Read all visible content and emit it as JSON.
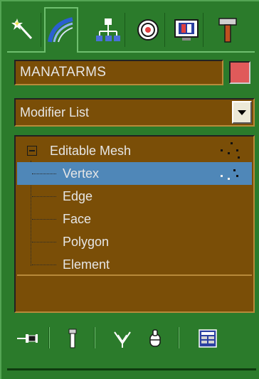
{
  "command_panel": {
    "tabs": [
      {
        "name": "create-tab",
        "icon": "create-star-icon"
      },
      {
        "name": "modify-tab",
        "icon": "modify-arc-icon"
      },
      {
        "name": "hierarchy-tab",
        "icon": "hierarchy-icon"
      },
      {
        "name": "motion-tab",
        "icon": "motion-circle-icon"
      },
      {
        "name": "display-tab",
        "icon": "display-monitor-icon"
      },
      {
        "name": "utilities-tab",
        "icon": "hammer-icon"
      }
    ],
    "active_tab": "modify-tab",
    "object_name": "MANATARMS",
    "object_color": "#e05a5a",
    "modifier_list_label": "Modifier List",
    "stack": {
      "root": "Editable Mesh",
      "items": [
        "Vertex",
        "Edge",
        "Face",
        "Polygon",
        "Element"
      ],
      "selected": "Vertex"
    },
    "toolbar_icons": [
      "pin-stack-icon",
      "show-end-result-icon",
      "make-unique-icon",
      "remove-modifier-icon",
      "configure-modifier-sets-icon"
    ]
  }
}
